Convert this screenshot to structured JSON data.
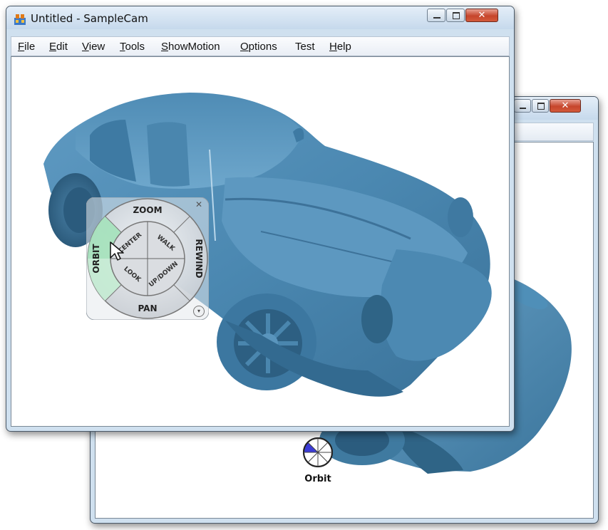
{
  "back_window": {
    "status_widget_label": "Orbit"
  },
  "front_window": {
    "title": "Untitled - SampleCam",
    "menu": [
      {
        "key": "F",
        "rest": "ile"
      },
      {
        "key": "E",
        "rest": "dit"
      },
      {
        "key": "V",
        "rest": "iew"
      },
      {
        "key": "T",
        "rest": "ools"
      },
      {
        "key": "S",
        "rest": "howMotion"
      },
      {
        "key": "O",
        "rest": "ptions"
      },
      {
        "key": "",
        "rest": "Test"
      },
      {
        "key": "H",
        "rest": "elp"
      }
    ]
  },
  "wheel": {
    "zoom": "ZOOM",
    "rewind": "REWIND",
    "pan": "PAN",
    "orbit": "ORBIT",
    "center": "CENTER",
    "walk": "WALK",
    "look": "LOOK",
    "updown": "UP/DOWN",
    "active_color": "#a6e2bd"
  },
  "colors": {
    "car_body": "#4f8fb8",
    "car_dark": "#2f6486",
    "car_light": "#7fb4d4"
  }
}
